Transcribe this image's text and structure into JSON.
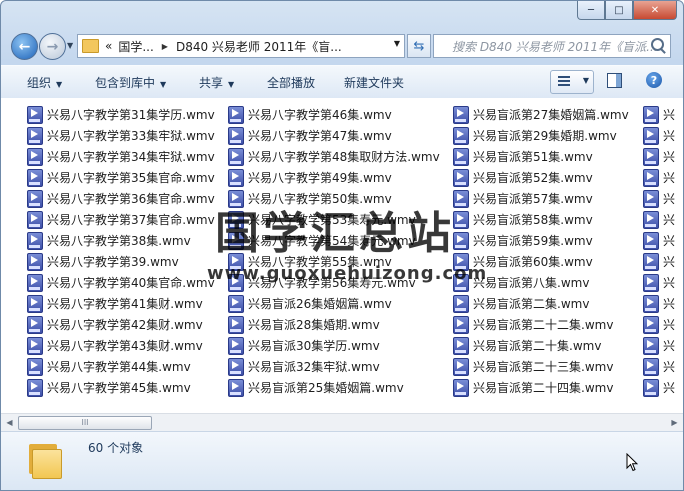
{
  "window": {
    "caption_buttons": [
      "─",
      "□",
      "✕"
    ]
  },
  "nav": {
    "back_symbol": "←",
    "forward_symbol": "→",
    "breadcrumb_prefix": "«",
    "breadcrumbs": [
      "国学...",
      "D840 兴易老师 2011年《盲..."
    ],
    "search_placeholder": "搜索 D840 兴易老师 2011年《盲派..."
  },
  "toolbar": {
    "organize": "组织",
    "include_in_library": "包含到库中",
    "share": "共享",
    "play_all": "全部播放",
    "new_folder": "新建文件夹",
    "help": "?"
  },
  "files": {
    "col1": [
      "兴易八字教学第31集学历.wmv",
      "兴易八字教学第33集牢狱.wmv",
      "兴易八字教学第34集牢狱.wmv",
      "兴易八字教学第35集官命.wmv",
      "兴易八字教学第36集官命.wmv",
      "兴易八字教学第37集官命.wmv",
      "兴易八字教学第38集.wmv",
      "兴易八字教学第39.wmv",
      "兴易八字教学第40集官命.wmv",
      "兴易八字教学第41集财.wmv",
      "兴易八字教学第42集财.wmv",
      "兴易八字教学第43集财.wmv",
      "兴易八字教学第44集.wmv",
      "兴易八字教学第45集.wmv"
    ],
    "col2": [
      "兴易八字教学第46集.wmv",
      "兴易八字教学第47集.wmv",
      "兴易八字教学第48集取财方法.wmv",
      "兴易八字教学第49集.wmv",
      "兴易八字教学第50集.wmv",
      "兴易八字教学第53集寿元.wmv",
      "兴易八字教学第54集寿元.wmv",
      "兴易八字教学第55集.wmv",
      "兴易八字教学第56集寿元.wmv",
      "兴易盲派26集婚姻篇.wmv",
      "兴易盲派28集婚期.wmv",
      "兴易盲派30集学历.wmv",
      "兴易盲派32集牢狱.wmv",
      "兴易盲派第25集婚姻篇.wmv"
    ],
    "col3": [
      "兴易盲派第27集婚姻篇.wmv",
      "兴易盲派第29集婚期.wmv",
      "兴易盲派第51集.wmv",
      "兴易盲派第52集.wmv",
      "兴易盲派第57集.wmv",
      "兴易盲派第58集.wmv",
      "兴易盲派第59集.wmv",
      "兴易盲派第60集.wmv",
      "兴易盲派第八集.wmv",
      "兴易盲派第二集.wmv",
      "兴易盲派第二十二集.wmv",
      "兴易盲派第二十集.wmv",
      "兴易盲派第二十三集.wmv",
      "兴易盲派第二十四集.wmv"
    ],
    "col4": [
      "兴",
      "兴",
      "兴",
      "兴",
      "兴",
      "兴",
      "兴",
      "兴",
      "兴",
      "兴",
      "兴",
      "兴",
      "兴",
      "兴"
    ]
  },
  "watermark": {
    "text": "国学汇总站",
    "url": "www.guoxuehuizong.com"
  },
  "scrollbar": {
    "thumb_grip": "III"
  },
  "status": {
    "object_count": "60 个对象"
  },
  "colors": {
    "toolbar_text": "#1e395b",
    "window_border": "#6f8aa9",
    "close_button": "#c74a32"
  }
}
